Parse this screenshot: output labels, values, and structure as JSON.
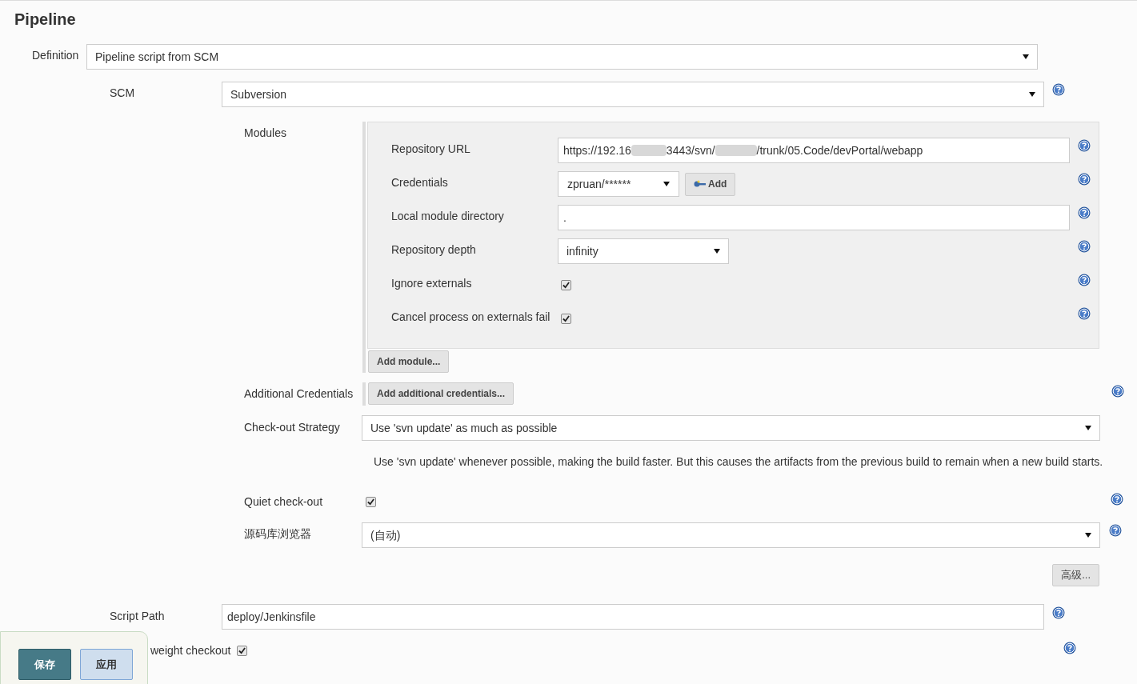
{
  "section_title": "Pipeline",
  "definition": {
    "label": "Definition",
    "value": "Pipeline script from SCM"
  },
  "scm": {
    "label": "SCM",
    "value": "Subversion"
  },
  "modules": {
    "label": "Modules",
    "fields": [
      {
        "kind": "url",
        "label": "Repository URL",
        "segments": [
          "https://192.16",
          "3443/svn/",
          "/trunk/05.Code/devPortal/webapp"
        ]
      },
      {
        "kind": "credentials",
        "label": "Credentials",
        "value": "zpruan/******",
        "button": "Add"
      },
      {
        "kind": "text",
        "label": "Local module directory",
        "value": "."
      },
      {
        "kind": "select",
        "label": "Repository depth",
        "value": "infinity"
      },
      {
        "kind": "checkbox",
        "label": "Ignore externals",
        "checked": true
      },
      {
        "kind": "checkbox",
        "label": "Cancel process on externals fail",
        "checked": true
      }
    ],
    "add_button": "Add module..."
  },
  "additional_credentials": {
    "label": "Additional Credentials",
    "button": "Add additional credentials..."
  },
  "checkout_strategy": {
    "label": "Check-out Strategy",
    "value": "Use 'svn update' as much as possible",
    "description": "Use 'svn update' whenever possible, making the build faster. But this causes the artifacts from the previous build to remain when a new build starts."
  },
  "quiet_checkout": {
    "label": "Quiet check-out",
    "checked": true
  },
  "repo_browser": {
    "label": "源码库浏览器",
    "value": "(自动)"
  },
  "advanced_button": "高级...",
  "script_path": {
    "label": "Script Path",
    "value": "deploy/Jenkinsfile"
  },
  "lightweight_checkout": {
    "label": "weight checkout",
    "checked": true
  },
  "bottom_bar": {
    "save": "保存",
    "apply": "应用"
  }
}
